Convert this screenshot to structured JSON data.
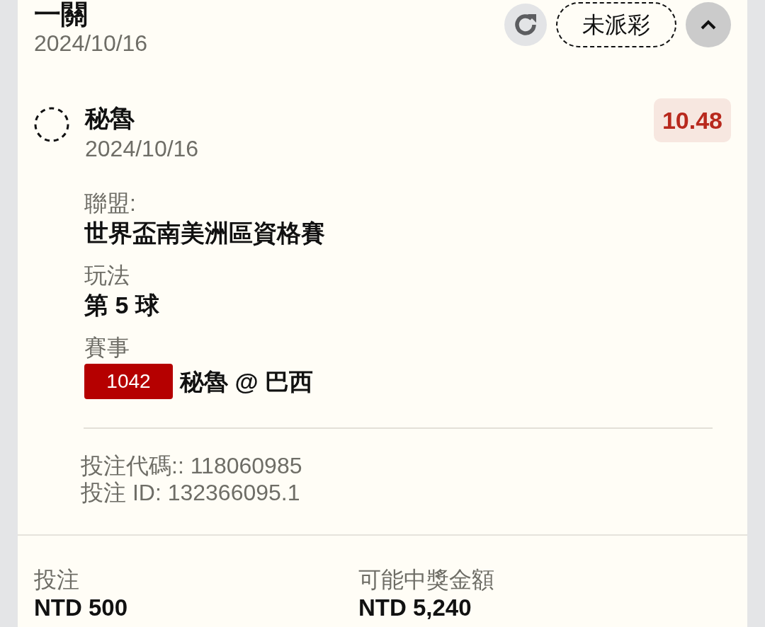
{
  "bet_card": {
    "title": "一關",
    "date": "2024/10/16",
    "status": "未派彩",
    "expanded": true,
    "selection": {
      "name": "秘魯",
      "date": "2024/10/16",
      "odds": "10.48",
      "settled": false
    },
    "details": [
      {
        "kind": "text",
        "label": "聯盟:",
        "value": "世界盃南美洲區資格賽"
      },
      {
        "kind": "text",
        "label": "玩法",
        "value": "第 5 球"
      },
      {
        "kind": "match",
        "label": "賽事",
        "match_code": "1042",
        "value": "秘魯 @ 巴西"
      }
    ],
    "bet_code": "投注代碼:: 118060985",
    "bet_id": "投注 ID: 132366095.1",
    "summary": [
      {
        "label": "投注",
        "value": "NTD 500"
      },
      {
        "label": "可能中獎金額",
        "value": "NTD 5,240"
      }
    ]
  }
}
